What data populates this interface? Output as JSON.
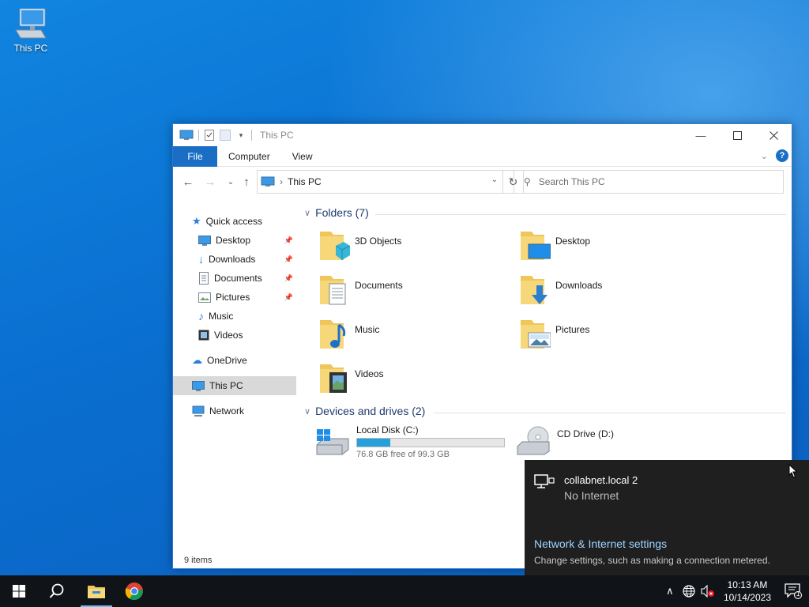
{
  "desktop": {
    "icons": [
      {
        "label": "This PC",
        "icon": "this-pc-icon"
      }
    ]
  },
  "explorer": {
    "title": "This PC",
    "ribbon_tabs": [
      "File",
      "Computer",
      "View"
    ],
    "address": {
      "location": "This PC"
    },
    "search": {
      "placeholder": "Search This PC"
    },
    "nav_pane": {
      "quick_access": "Quick access",
      "quick_items": [
        {
          "label": "Desktop",
          "pinned": true
        },
        {
          "label": "Downloads",
          "pinned": true
        },
        {
          "label": "Documents",
          "pinned": true
        },
        {
          "label": "Pictures",
          "pinned": true
        },
        {
          "label": "Music",
          "pinned": false
        },
        {
          "label": "Videos",
          "pinned": false
        }
      ],
      "onedrive": "OneDrive",
      "this_pc": "This PC",
      "network": "Network"
    },
    "folders_header": "Folders (7)",
    "folders": [
      "3D Objects",
      "Desktop",
      "Documents",
      "Downloads",
      "Music",
      "Pictures",
      "Videos"
    ],
    "devices_header": "Devices and drives (2)",
    "drives": [
      {
        "name": "Local Disk (C:)",
        "free_text": "76.8 GB free of 99.3 GB",
        "used_fraction": 0.227
      },
      {
        "name": "CD Drive (D:)"
      }
    ],
    "status": "9 items"
  },
  "network_flyout": {
    "network_name": "collabnet.local 2",
    "network_status": "No Internet",
    "settings_link": "Network & Internet settings",
    "settings_desc": "Change settings, such as making a connection metered."
  },
  "taskbar": {
    "time": "10:13 AM",
    "date": "10/14/2023",
    "notification_count": "1"
  },
  "colors": {
    "accent": "#1a6fc4",
    "selection": "#d9d9d9",
    "flyout_bg": "#1f1f1f",
    "link": "#9fd3ff",
    "drive_bar": "#26a0da"
  }
}
